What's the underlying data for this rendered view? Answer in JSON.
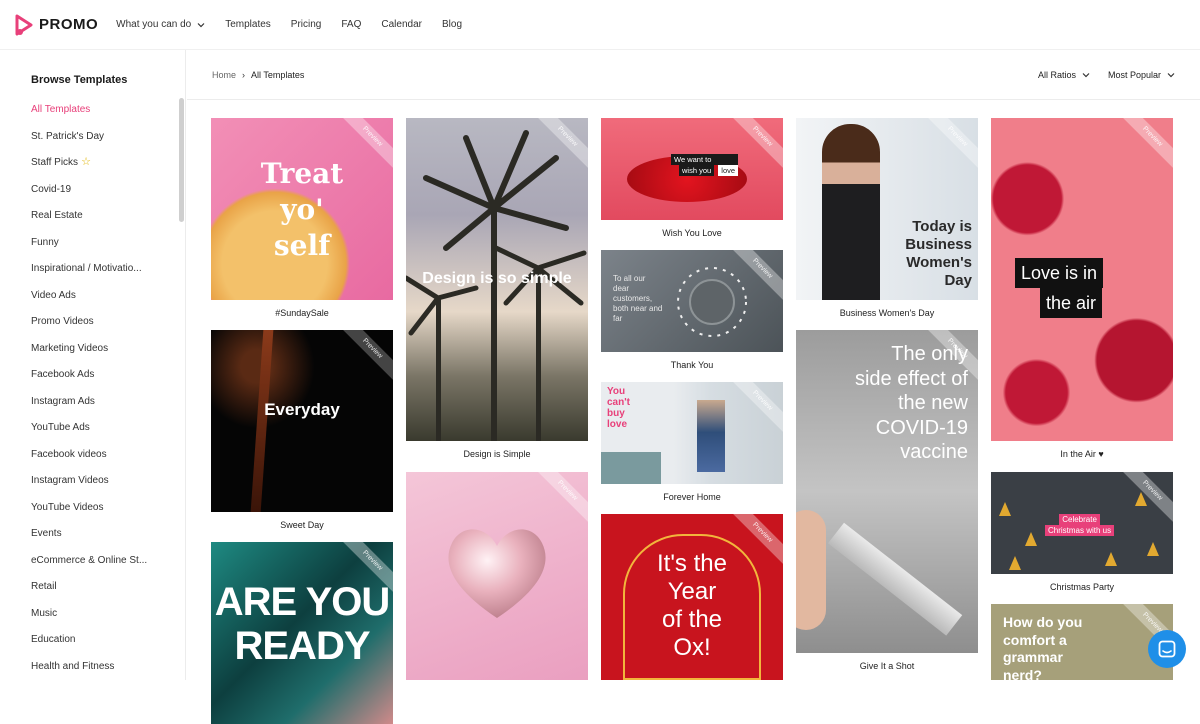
{
  "brand": {
    "name": "PROMO",
    "accent": "#e8407a"
  },
  "nav": {
    "items": [
      "What you can do",
      "Templates",
      "Pricing",
      "FAQ",
      "Calendar",
      "Blog"
    ]
  },
  "sidebar": {
    "title": "Browse Templates",
    "items": [
      "All Templates",
      "St. Patrick's Day",
      "Staff Picks",
      "Covid-19",
      "Real Estate",
      "Funny",
      "Inspirational / Motivatio...",
      "Video Ads",
      "Promo Videos",
      "Marketing Videos",
      "Facebook Ads",
      "Instagram Ads",
      "YouTube Ads",
      "Facebook videos",
      "Instagram Videos",
      "YouTube Videos",
      "Events",
      "eCommerce & Online St...",
      "Retail",
      "Music",
      "Education",
      "Health and Fitness"
    ],
    "active_index": 0
  },
  "breadcrumb": {
    "home": "Home",
    "current": "All Templates"
  },
  "filters": {
    "ratio": "All Ratios",
    "sort": "Most Popular"
  },
  "preview_label": "Preview",
  "cards": {
    "sunday": {
      "caption": "#SundaySale",
      "lines": [
        "Treat",
        "yo'",
        "self"
      ]
    },
    "sweet": {
      "caption": "Sweet Day",
      "title": "Everyday"
    },
    "ready": {
      "lines": [
        "ARE YOU",
        "READY"
      ]
    },
    "design": {
      "caption": "Design is Simple",
      "title": "Design is so simple"
    },
    "wish": {
      "caption": "Wish You Love",
      "lines": [
        "We want to",
        "wish you",
        "love"
      ]
    },
    "thank": {
      "caption": "Thank You",
      "text": "To all our dear customers, both near and far"
    },
    "forever": {
      "caption": "Forever Home",
      "text": "You can't buy love"
    },
    "ox": {
      "lines": [
        "It's the",
        "Year",
        "of the",
        "Ox!"
      ]
    },
    "women": {
      "caption": "Business Women's Day",
      "text": "Today is Business Women's Day"
    },
    "shot": {
      "caption": "Give It a Shot",
      "text": "The only side effect of the new COVID-19 vaccine"
    },
    "air": {
      "caption": "In the Air ♥",
      "lines": [
        "Love is in",
        "the air"
      ]
    },
    "xmas": {
      "caption": "Christmas Party",
      "lines": [
        "Celebrate",
        "Christmas with us"
      ]
    },
    "grammar": {
      "text": "How do you comfort a grammar nerd?"
    }
  }
}
